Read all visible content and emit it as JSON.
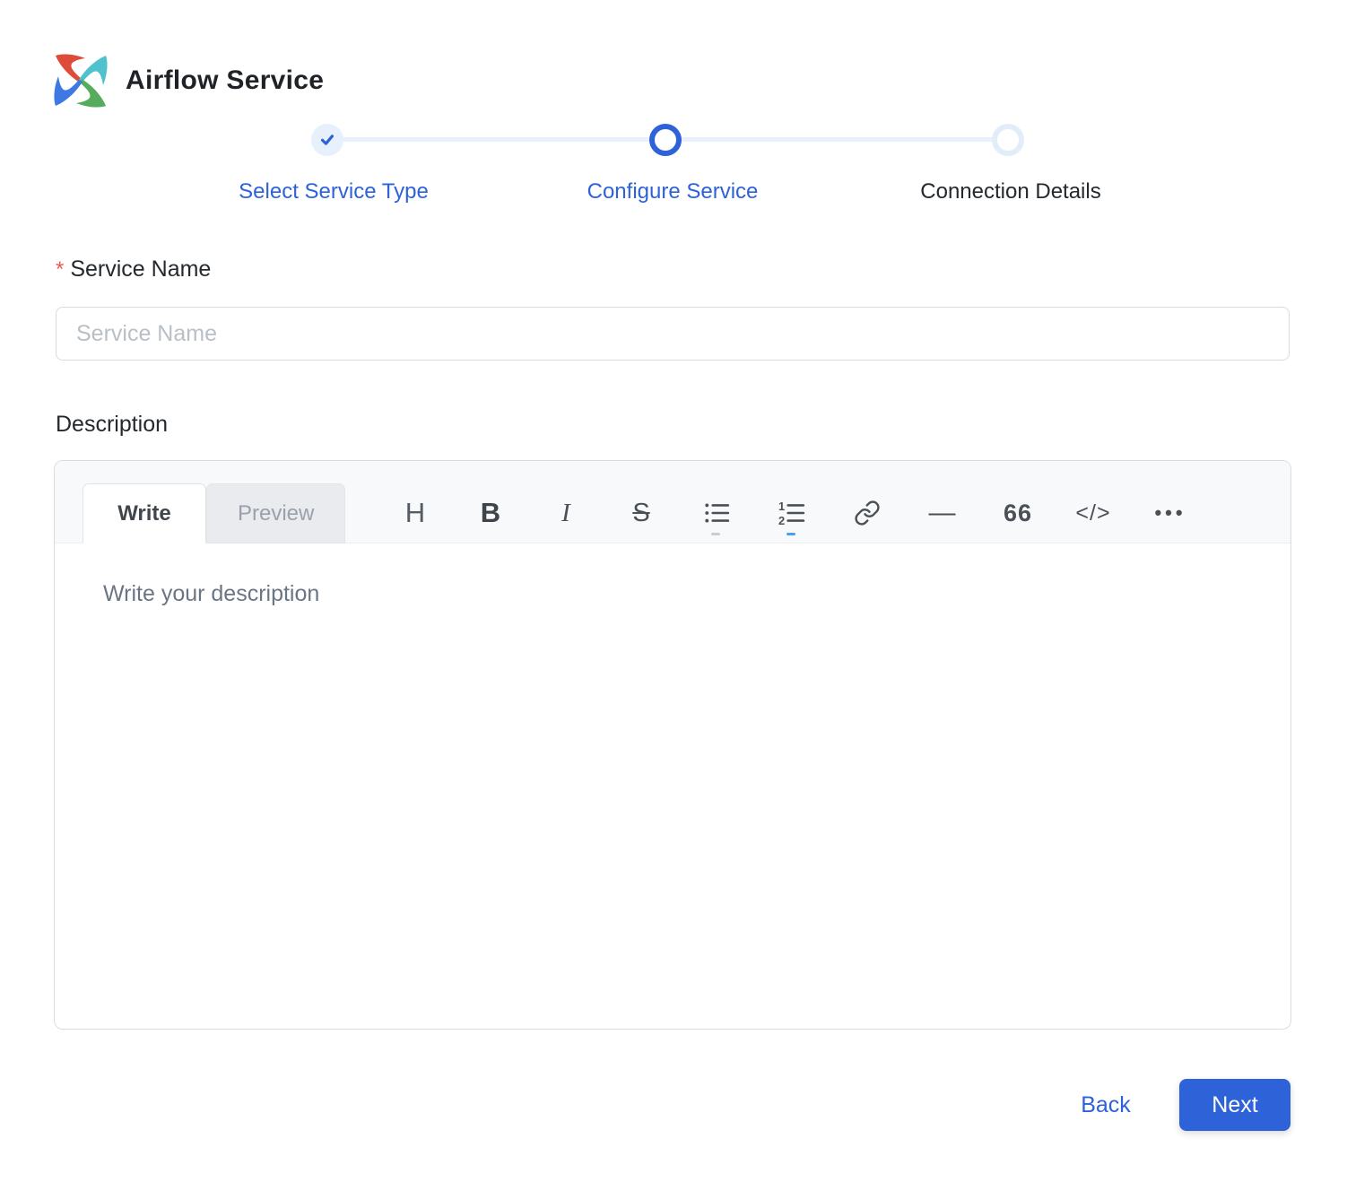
{
  "header": {
    "title": "Airflow Service",
    "logo": "airflow-pinwheel"
  },
  "stepper": {
    "steps": [
      {
        "label": "Select Service Type",
        "state": "completed"
      },
      {
        "label": "Configure Service",
        "state": "active"
      },
      {
        "label": "Connection Details",
        "state": "upcoming"
      }
    ]
  },
  "form": {
    "service_name": {
      "label": "Service Name",
      "required_marker": "*",
      "placeholder": "Service Name",
      "value": ""
    },
    "description": {
      "label": "Description",
      "editor": {
        "tabs": [
          {
            "label": "Write",
            "active": true
          },
          {
            "label": "Preview",
            "active": false
          }
        ],
        "toolbar": [
          "heading",
          "bold",
          "italic",
          "strikethrough",
          "bulleted-list",
          "numbered-list",
          "link",
          "horizontal-rule",
          "quote",
          "code",
          "more"
        ],
        "placeholder": "Write your description",
        "value": ""
      }
    }
  },
  "icons": {
    "heading": "H",
    "bold": "B",
    "italic": "I",
    "strikethrough": "S",
    "horizontal_rule": "—",
    "quote": "66",
    "code": "</>",
    "more": "•••"
  },
  "footer": {
    "back_label": "Back",
    "next_label": "Next"
  },
  "colors": {
    "primary_blue": "#2E62D9",
    "step_line_blue": "#E8F0FC",
    "completed_circle_bg": "#E7F0FD",
    "pending_ring": "#E3EDFA",
    "required_red": "#ED5A4F",
    "toolbar_bg": "#F8F9FB",
    "border_gray": "#D9DDE3",
    "logo_red": "#DE4B38",
    "logo_teal": "#4FC2CD",
    "logo_green": "#55AC5C",
    "logo_blue": "#3D78E3"
  }
}
